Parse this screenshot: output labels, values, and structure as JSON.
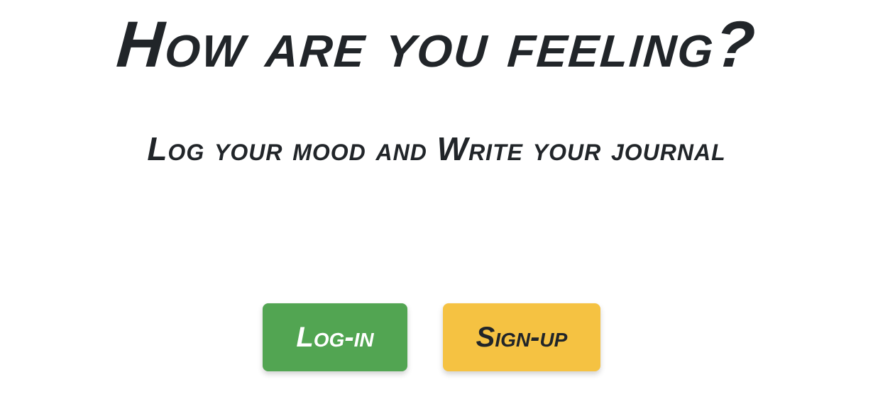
{
  "hero": {
    "title": "How are you feeling?",
    "subtitle": "Log your mood and Write your journal"
  },
  "actions": {
    "login_label": "Log-in",
    "signup_label": "Sign-up"
  },
  "colors": {
    "login": "#52a552",
    "signup": "#f5c242",
    "text": "#212529"
  }
}
